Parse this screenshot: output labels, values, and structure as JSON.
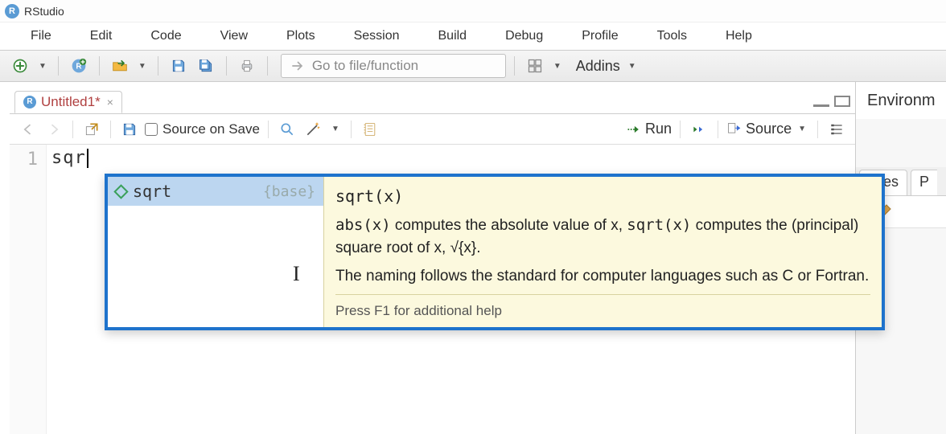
{
  "app": {
    "title": "RStudio",
    "icon_letter": "R"
  },
  "menu": {
    "items": [
      "File",
      "Edit",
      "Code",
      "View",
      "Plots",
      "Session",
      "Build",
      "Debug",
      "Profile",
      "Tools",
      "Help"
    ]
  },
  "toolbar": {
    "goto_placeholder": "Go to file/function",
    "addins_label": "Addins"
  },
  "editor": {
    "tab": {
      "icon_letter": "R",
      "title": "Untitled1*"
    },
    "source_on_save_label": "Source on Save",
    "run_label": "Run",
    "source_label": "Source",
    "gutter_line": "1",
    "code_text": "sqr"
  },
  "right_pane": {
    "env_tab": "Environm",
    "files_tab": "Files",
    "plots_tab_letter": "P"
  },
  "autocomplete": {
    "item": {
      "name": "sqrt",
      "package": "{base}"
    },
    "help": {
      "signature": "sqrt(x)",
      "para1_pre_code1": "abs(x)",
      "para1_mid": " computes the absolute value of x, ",
      "para1_code2": "sqrt(x)",
      "para1_post": " computes the (principal) square root of x, √{x}.",
      "para2": "The naming follows the standard for computer languages such as C or Fortran.",
      "footer": "Press F1 for additional help"
    }
  }
}
